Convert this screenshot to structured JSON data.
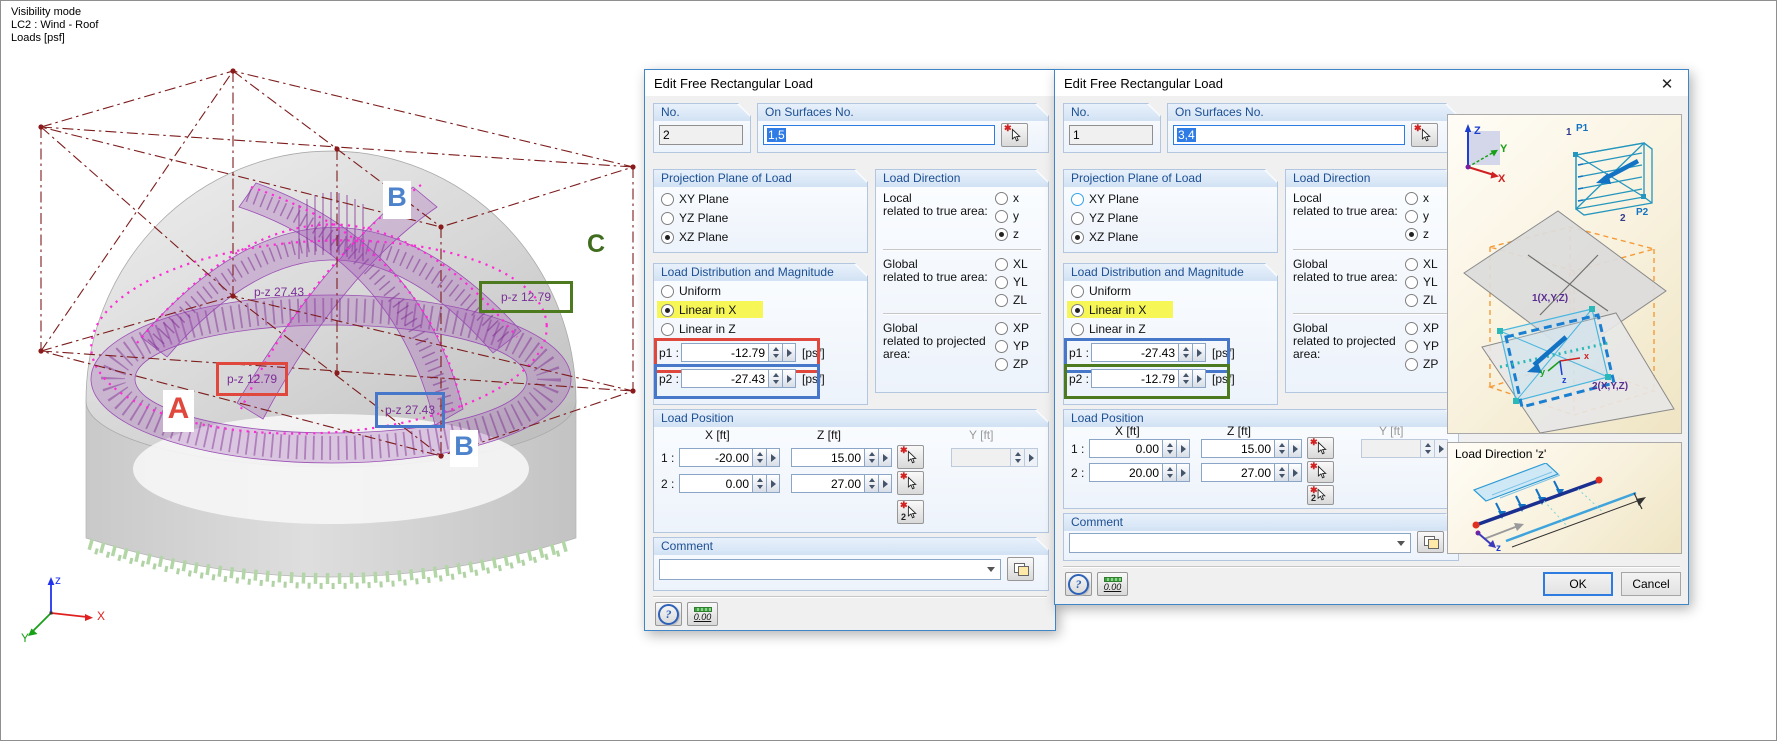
{
  "info": {
    "line1": "Visibility mode",
    "line2": "LC2 : Wind - Roof",
    "line3": "Loads [psf]"
  },
  "scene": {
    "marker_a": "A",
    "marker_b_top": "B",
    "marker_b_bottom": "B",
    "marker_c": "C",
    "tag_top": "p-z 27.43",
    "tag_green": "p-z 12.79",
    "tag_red": "p-z 12.79",
    "tag_blue": "p-z 27.43",
    "axis": {
      "x": "X",
      "y": "Y",
      "z": "z"
    }
  },
  "colors": {
    "annotation_red": "#e0483d",
    "annotation_blue": "#4777c8",
    "annotation_green": "#4d7a1e",
    "highlight_yellow": "#f7f657",
    "load_violet": "#9a4fb4",
    "outline_magenta": "#ff2bd6"
  },
  "icons": {
    "close": "✕",
    "help": "?",
    "units": "0.00",
    "pick2": "2"
  },
  "left": {
    "title": "Edit Free Rectangular Load",
    "no_label": "No.",
    "no_value": "2",
    "surf_label": "On Surfaces No.",
    "surf_value": "1,5",
    "projection": {
      "title": "Projection Plane of Load",
      "options": [
        "XY Plane",
        "YZ Plane",
        "XZ Plane"
      ]
    },
    "direction": {
      "title": "Load Direction",
      "local": "Local",
      "local_sub": "related to true area:",
      "global": "Global",
      "global_sub": "related to true area:",
      "global2": "Global",
      "global2_sub": "related to projected",
      "global2_sub2": "area:",
      "options": [
        "x",
        "y",
        "z",
        "XL",
        "YL",
        "ZL",
        "XP",
        "YP",
        "ZP"
      ]
    },
    "distribution": {
      "title": "Load Distribution and Magnitude",
      "options": [
        "Uniform",
        "Linear in X",
        "Linear in Z"
      ],
      "p1_label": "p1 :",
      "p1_value": "-12.79",
      "p2_label": "p2 :",
      "p2_value": "-27.43",
      "unit": "[psf]"
    },
    "position": {
      "title": "Load Position",
      "col_x": "X [ft]",
      "col_z": "Z [ft]",
      "col_y": "Y [ft]",
      "r1_idx": "1 :",
      "r1_x": "-20.00",
      "r1_z": "15.00",
      "r2_idx": "2 :",
      "r2_x": "0.00",
      "r2_z": "27.00"
    },
    "comment": {
      "title": "Comment",
      "value": ""
    }
  },
  "right": {
    "title": "Edit Free Rectangular Load",
    "no_label": "No.",
    "no_value": "1",
    "surf_label": "On Surfaces No.",
    "surf_value": "3,4",
    "projection": {
      "title": "Projection Plane of Load",
      "options": [
        "XY Plane",
        "YZ Plane",
        "XZ Plane"
      ]
    },
    "direction": {
      "title": "Load Direction",
      "local": "Local",
      "local_sub": "related to true area:",
      "global": "Global",
      "global_sub": "related to true area:",
      "global2": "Global",
      "global2_sub": "related to projected",
      "global2_sub2": "area:",
      "options": [
        "x",
        "y",
        "z",
        "XL",
        "YL",
        "ZL",
        "XP",
        "YP",
        "ZP"
      ]
    },
    "distribution": {
      "title": "Load Distribution and Magnitude",
      "options": [
        "Uniform",
        "Linear in X",
        "Linear in Z"
      ],
      "p1_label": "p1 :",
      "p1_value": "-27.43",
      "p2_label": "p2 :",
      "p2_value": "-12.79",
      "unit": "[psf]"
    },
    "position": {
      "title": "Load Position",
      "col_x": "X [ft]",
      "col_z": "Z [ft]",
      "col_y": "Y [ft]",
      "r1_idx": "1 :",
      "r1_x": "0.00",
      "r1_z": "15.00",
      "r2_idx": "2 :",
      "r2_x": "20.00",
      "r2_z": "27.00"
    },
    "comment": {
      "title": "Comment",
      "value": ""
    },
    "illus": {
      "n1": "1",
      "p1": "P1",
      "n2": "2",
      "p2": "P2",
      "pt1": "1(X,Y,Z)",
      "pt2": "2(X,Y,Z)",
      "ax": "X",
      "ay": "Y",
      "az": "Z",
      "lx": "x",
      "ly": "y",
      "lz": "z"
    },
    "panel2_title": "Load Direction 'z'",
    "ok": "OK",
    "cancel": "Cancel"
  }
}
